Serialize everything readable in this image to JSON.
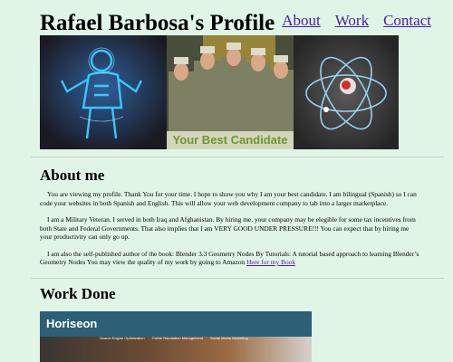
{
  "header": {
    "title": "Rafael Barbosa's Profile",
    "nav": [
      {
        "label": "About"
      },
      {
        "label": "Work"
      },
      {
        "label": "Contact"
      }
    ]
  },
  "hero": {
    "banner_text": "Your Best Candidate"
  },
  "about": {
    "heading": "About me",
    "p1": "You are viewing my profile. Thank You for your time. I hope to show you why I am your best candidate. I am bilingual (Spanish) so I can code your websites in both Spanish and English. This will allow your web development company to tab into a larger marketplace.",
    "p2": "I am a Military Veteran. I served in both Iraq and Afghanistan. By hiring me, your company may be elegible for some tax incentives from both State and Federal Governments. That also implies that I am VERY GOOD UNDER PRESSURE!!! You can expect that by hiring me your productivity can only go up.",
    "p3": "I am also the self-published author of the book: Blender 3.3 Geometry Nodes By Tutorials: A tutorial based approach to learning Blender’s Geometry Nodes You may view the quality of my work by going to Amazon",
    "book_link": "Here for my Book"
  },
  "work": {
    "heading": "Work Done",
    "card": {
      "logo": "Horiseon",
      "nav": [
        "Search Engine Optimization",
        "Online Reputation Management",
        "Social Media Marketing"
      ]
    }
  }
}
